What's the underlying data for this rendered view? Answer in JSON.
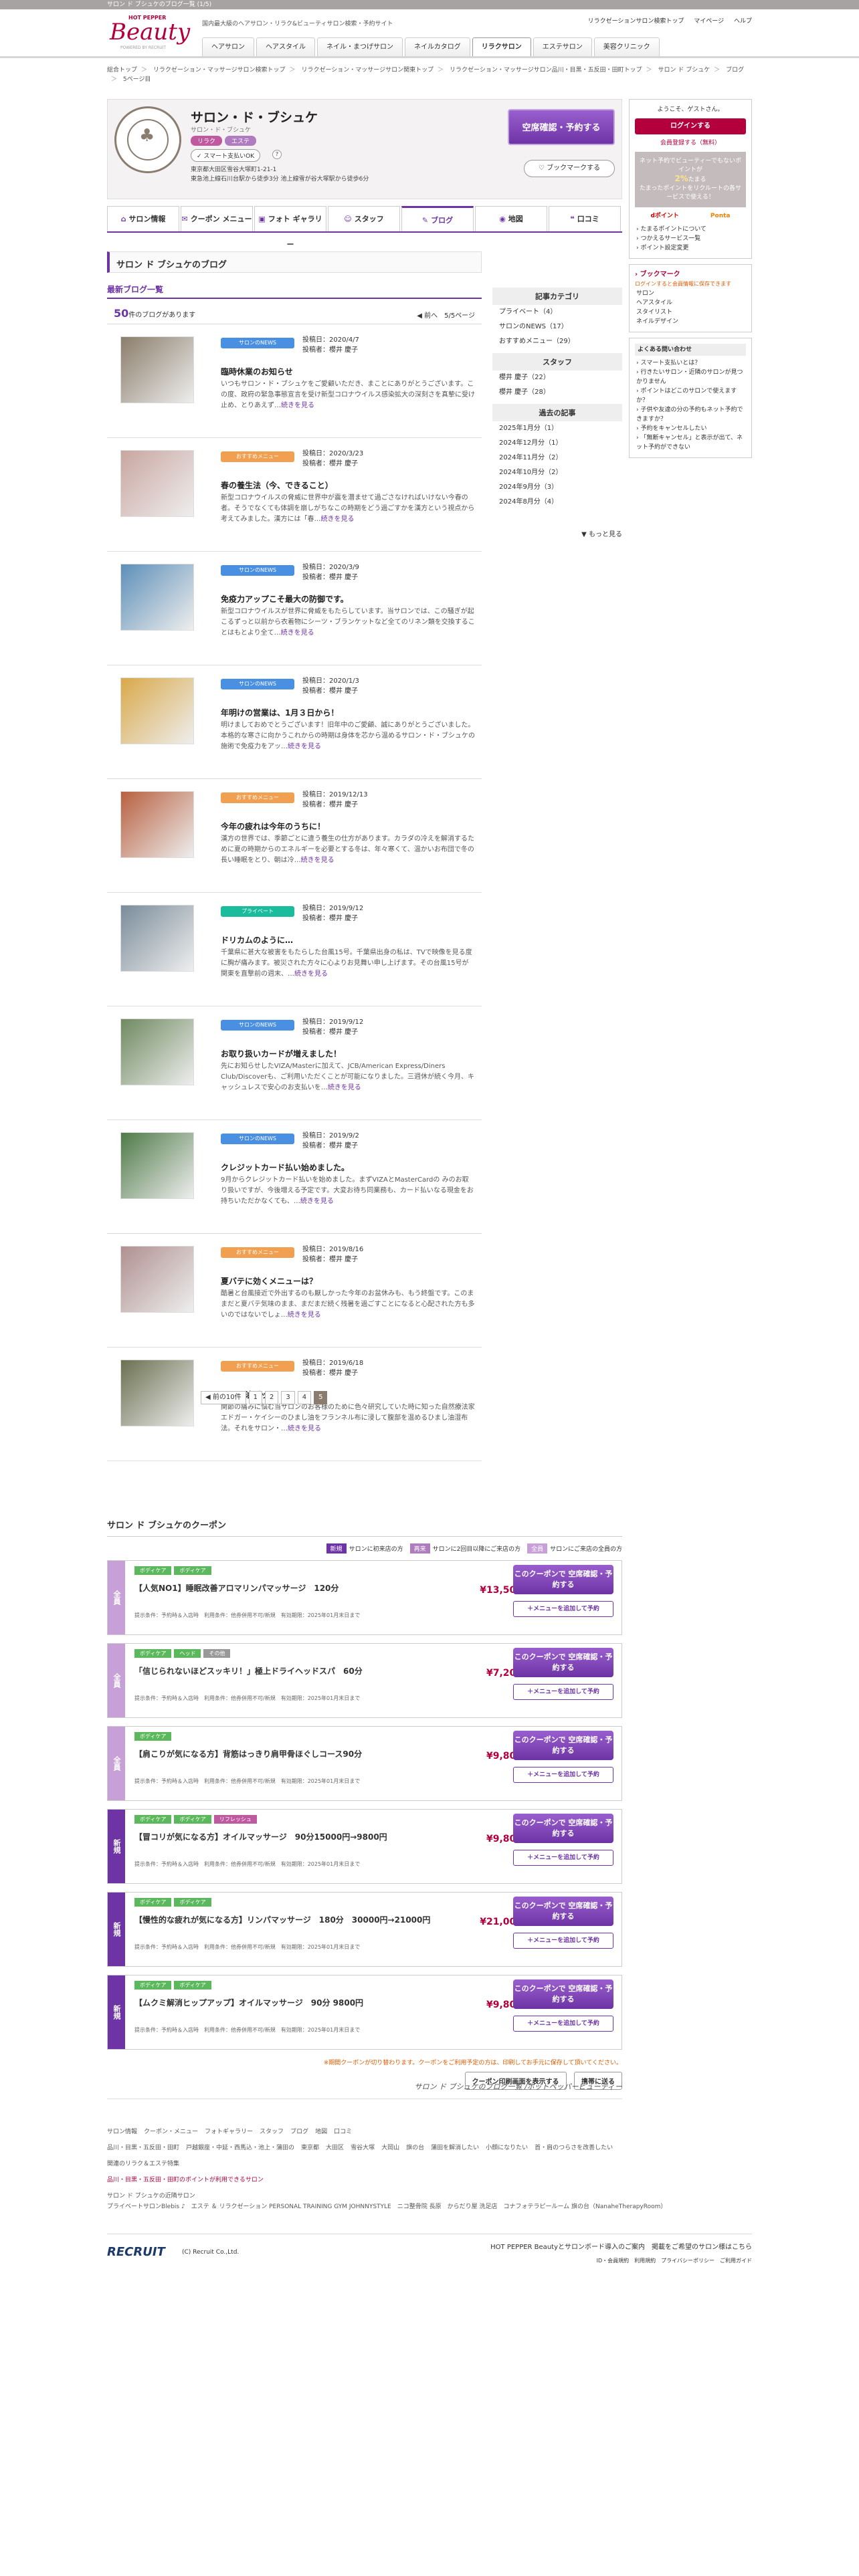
{
  "topbar": "サロン ド ブシュケのブログ一覧 (1/5)",
  "brand": {
    "hotpepper": "HOT PEPPER",
    "beauty": "Beauty",
    "powered": "POWERED BY RECRUIT"
  },
  "header": {
    "desc": "国内最大級のヘアサロン・リラク&ビューティサロン検索・予約サイト",
    "links": [
      "リラクゼーションサロン検索トップ",
      "マイページ",
      "ヘルプ"
    ]
  },
  "gnav": [
    "ヘアサロン",
    "ヘアスタイル",
    "ネイル・まつげサロン",
    "ネイルカタログ",
    "リラクサロン",
    "エステサロン",
    "美容クリニック"
  ],
  "breadcrumb": [
    "総合トップ",
    "リラクゼーション・マッサージサロン検索トップ",
    "リラクゼーション・マッサージサロン関東トップ",
    "リラクゼーション・マッサージサロン品川・目黒・五反田・田町トップ",
    "サロン ド ブシュケ",
    "ブログ",
    "5ページ目"
  ],
  "salon": {
    "name": "サロン・ド・ブシュケ",
    "kana": "サロン・ド・ブシュケ",
    "tags": [
      "リラク",
      "エステ"
    ],
    "smart_pay": "スマート支払いOK",
    "address1": "東京都大田区雪谷大塚町1-21-1",
    "address2": "東急池上線石川台駅から徒歩3分 池上線雪が谷大塚駅から徒歩6分",
    "reserve_label": "空席確認・予約する",
    "bookmark_label": "ブックマークする"
  },
  "subnav": [
    {
      "icon": "⌂",
      "label": "サロン情報"
    },
    {
      "icon": "✉",
      "label": "クーポン メニュー"
    },
    {
      "icon": "▣",
      "label": "フォト ギャラリー"
    },
    {
      "icon": "☺",
      "label": "スタッフ"
    },
    {
      "icon": "✎",
      "label": "ブログ"
    },
    {
      "icon": "◉",
      "label": "地図"
    },
    {
      "icon": "❝",
      "label": "口コミ"
    }
  ],
  "blog": {
    "heading": "サロン ド ブシュケのブログ",
    "latest": "最新ブログ一覧",
    "count": "50",
    "count_suffix": "件のブログがあります",
    "prev": "◀ 前へ",
    "page": "5/5ページ",
    "author_label": "投稿者：",
    "date_label": "投稿日：",
    "posts": [
      {
        "category": "サロンのNEWS",
        "date": "2020/4/7",
        "author": "櫻井 慶子",
        "title": "臨時休業のお知らせ",
        "body": "いつもサロン・ド・ブシュケをご愛顧いただき、まことにありがとうございます。この度、政府の緊急事態宣言を受け新型コロナウイルス感染拡大の深刻さを真摯に受け止め、とりあえず…",
        "more": "続きを見る",
        "color": "#4a90e2"
      },
      {
        "category": "おすすめメニュー",
        "date": "2020/3/23",
        "author": "櫻井 慶子",
        "title": "春の養生法（今、できること）",
        "body": "新型コロナウイルスの脅威に世界中が震を潜ませて過ごさなければいけない今春の者。そうでなくても体調を崩しがちなこの時期をどう過ごすかを漢方という視点から考えてみました。漢方には「春…",
        "more": "続きを見る",
        "color": "#f0a050"
      },
      {
        "category": "サロンのNEWS",
        "date": "2020/3/9",
        "author": "櫻井 慶子",
        "title": "免疫力アップこそ最大の防御です。",
        "body": "新型コロナウイルスが世界に脅威をもたらしています。当サロンでは、この騒ぎが起こるずっと以前から衣着物にシーツ・ブランケットなど全てのリネン類を交換することはもとより全て…",
        "more": "続きを見る",
        "color": "#4a90e2"
      },
      {
        "category": "サロンのNEWS",
        "date": "2020/1/3",
        "author": "櫻井 慶子",
        "title": "年明けの営業は、1月３日から！",
        "body": "明けましておめでとうございます！旧年中のご愛顧、誠にありがとうございました。本格的な寒さに向かうこれからの時期は身体を芯から温めるサロン・ド・ブシュケの施術で免疫力をアッ…",
        "more": "続きを見る",
        "color": "#4a90e2"
      },
      {
        "category": "おすすめメニュー",
        "date": "2019/12/13",
        "author": "櫻井 慶子",
        "title": "今年の疲れは今年のうちに！",
        "body": "漢方の世界では、季節ごとに違う養生の仕方があります。カラダの冷えを解消するために夏の時期からのエネルギーを必要とする冬は、年々寒くて、温かいお布団で冬の長い睡眠をとり、朝は冷…",
        "more": "続きを見る",
        "color": "#f0a050"
      },
      {
        "category": "プライベート",
        "date": "2019/9/12",
        "author": "櫻井 慶子",
        "title": "ドリカムのように…",
        "body": "千葉県に甚大な被害をもたらした台風15号。千葉県出身の私は、TVで映像を見る度に胸が痛みます。被災された方々に心よりお見舞い申し上げます。その台風15号が関東を直撃前の週末、…",
        "more": "続きを見る",
        "color": "#1abc9c"
      },
      {
        "category": "サロンのNEWS",
        "date": "2019/9/12",
        "author": "櫻井 慶子",
        "title": "お取り扱いカードが増えました！",
        "body": "先にお知らせしたVIZA/Masterに加えて、JCB/American Express/Diners Club/Discoverも、ご利用いただくことが可能になりました。三週休が続く今月、キャッシュレスで安心のお支払いを…",
        "more": "続きを見る",
        "color": "#4a90e2"
      },
      {
        "category": "サロンのNEWS",
        "date": "2019/9/2",
        "author": "櫻井 慶子",
        "title": "クレジットカード払い始めました。",
        "body": "9月からクレジットカード払いを始めました。まずVIZAとMasterCardの みのお取り扱いですが、今後増える予定です。大変お待ち同業務も、カード払いなる現金をお持ちいただかなくても、…",
        "more": "続きを見る",
        "color": "#4a90e2"
      },
      {
        "category": "おすすめメニュー",
        "date": "2019/8/16",
        "author": "櫻井 慶子",
        "title": "夏バテに効くメニューは？",
        "body": "酷暑と台風接近で外出するのも厭しかった今年のお盆休みも、もう終盤です。このままだと夏バテ気味のまま、まだまだ続く残暑を過ごすことになると心配された方も多いのではないでしょ…",
        "more": "続きを見る",
        "color": "#f0a050"
      },
      {
        "category": "おすすめメニュー",
        "date": "2019/6/18",
        "author": "櫻井 慶子",
        "title": "ひまし油パック",
        "body": "関節の痛みに悩む当サロンのお客様のために色々研究していた時に知った自然療法家エドガー・ケイシーのひまし油をフランネル布に浸して腹部を温めるひまし油湿布法。それをサロン・…",
        "more": "続きを見る",
        "color": "#f0a050"
      }
    ],
    "pager": [
      "◀ 前の10件",
      "1",
      "2",
      "3",
      "4",
      "5"
    ]
  },
  "side": {
    "cat_title": "記事カテゴリ",
    "cats": [
      "プライベート（4）",
      "サロンのNEWS（17）",
      "おすすめメニュー（29）"
    ],
    "staff_title": "スタッフ",
    "staff": [
      "櫻井 慶子（22）",
      "櫻井 慶子（28）"
    ],
    "archive_title": "過去の記事",
    "archive": [
      "2025年1月分（1）",
      "2024年12月分（1）",
      "2024年11月分（2）",
      "2024年10月分（2）",
      "2024年9月分（3）",
      "2024年8月分（4）"
    ],
    "more": "▼ もっと見る"
  },
  "right": {
    "welcome": "ようこそ、ゲストさん。",
    "login": "ログインする",
    "register": "会員登録する（無料）",
    "promo1": "ネット予約でビューティーでもないポイントが",
    "promo_pct": "2%",
    "promo2": "たまる",
    "promo3": "たまったポイントをリクルートの各サービスで使える！",
    "ponta": "Ponta",
    "dpoint": "dポイント",
    "links": [
      "たまるポイントについて",
      "つかえるサービス一覧",
      "ポイント設定変更"
    ],
    "bm_title": "ブックマーク",
    "bm_note": "ログインすると会員情報に保存できます",
    "bm_items": [
      "サロン",
      "ヘアスタイル",
      "スタイリスト",
      "ネイルデザイン"
    ],
    "faq_title": "よくある問い合わせ",
    "faq": [
      "スマート支払いとは？",
      "行きたいサロン・近隣のサロンが見つかりません",
      "ポイントはどこのサロンで使えますか？",
      "子供や友達の分の予約もネット予約できますか？",
      "予約をキャンセルしたい",
      "「無断キャンセル」と表示が出て、ネット予約ができない"
    ]
  },
  "coupons": {
    "heading": "サロン ド ブシュケのクーポン",
    "legend": [
      {
        "k": "新規",
        "v": "サロンに初来店の方",
        "c": "#6e34a6"
      },
      {
        "k": "再来",
        "v": "サロンに2回目以降にご来店の方",
        "c": "#b07cc0"
      },
      {
        "k": "全員",
        "v": "サロンにご来店の全員の方",
        "c": "#c8a0d8"
      }
    ],
    "items": [
      {
        "type": "全員",
        "tags": [
          "ボディケア",
          "ボディケア"
        ],
        "title": "【人気NO1】睡眠改善アロマリンパマッサージ　120分",
        "price": "¥13,500",
        "c": "#c8a0d8"
      },
      {
        "type": "全員",
        "tags": [
          "ボディケア",
          "ヘッド",
          "その他"
        ],
        "title": "「信じられないほどスッキリ！」極上ドライヘッドスパ　60分",
        "price": "¥7,200",
        "c": "#c8a0d8"
      },
      {
        "type": "全員",
        "tags": [
          "ボディケア"
        ],
        "title": "【肩こりが気になる方】背筋はっきり肩甲骨ほぐしコース90分",
        "price": "¥9,800",
        "c": "#c8a0d8"
      },
      {
        "type": "新規",
        "tags": [
          "ボディケア",
          "ボディケア",
          "リフレッシュ"
        ],
        "title": "【冒コリが気になる方】オイルマッサージ　90分15000円→9800円",
        "price": "¥9,800",
        "c": "#6e34a6"
      },
      {
        "type": "新規",
        "tags": [
          "ボディケア",
          "ボディケア"
        ],
        "title": "【慢性的な疲れが気になる方】リンパマッサージ　180分　30000円→21000円",
        "price": "¥21,000",
        "c": "#6e34a6"
      },
      {
        "type": "新規",
        "tags": [
          "ボディケア",
          "ボディケア"
        ],
        "title": "【ムクミ解消ヒップアップ】オイルマッサージ　90分 9800円",
        "price": "¥9,800",
        "c": "#6e34a6"
      }
    ],
    "cond": "提示条件：予約時＆入店時　利用条件：他券併用不可/新規　有効期限：2025年01月末日まで",
    "btn1": "このクーポンで 空席確認・予約する",
    "btn2": "＋メニューを追加して予約",
    "note": "※期間クーポンが切り替わります。クーポンをご利用予定の方は、印刷してお手元に保存して頂いてください。",
    "print": "クーポン印刷画面を表示する",
    "back": "携帯に送る"
  },
  "sub_footer": "サロン ド ブシュケのブログ一覧 /ホットペッパービューティー",
  "footer": {
    "row1": [
      "サロン情報",
      "クーポン・メニュー",
      "フォトギャラリー",
      "スタッフ",
      "ブログ",
      "地図",
      "口コミ"
    ],
    "row2": [
      "品川・目黒・五反田・田町",
      "戸越銀座・中延・西馬込・池上・蒲田の",
      "東京都",
      "大田区",
      "雪谷大塚",
      "大岡山",
      "旗の台",
      "蒲田を解消したい",
      "小顔になりたい",
      "首・肩のつらさを改善したい"
    ],
    "row3": "関連のリラク＆エステ特集",
    "row4": "品川・目黒・五反田・田町のポイントが利用できるサロン",
    "row5": "サロン ド ブシュケの近隣サロン",
    "row6": "プライベートサロンBlebis ♪　エステ ＆ リラクゼーション PERSONAL TRAINING GYM JOHNNYSTYLE　ニコ整骨院 長原　からだり屋 洗足店　コナフォテラピールーム 旗の台（NanaheTherapyRoom）"
  },
  "bottom": {
    "recruit": "RECRUIT",
    "copyright": "(C) Recruit Co.,Ltd.",
    "link1": "HOT PEPPER Beautyとサロンボード導入のご案内　掲載をご希望のサロン様はこちら",
    "link2": "ID・会員規約　利用規約　プライバシーポリシー　ご利用ガイド"
  }
}
